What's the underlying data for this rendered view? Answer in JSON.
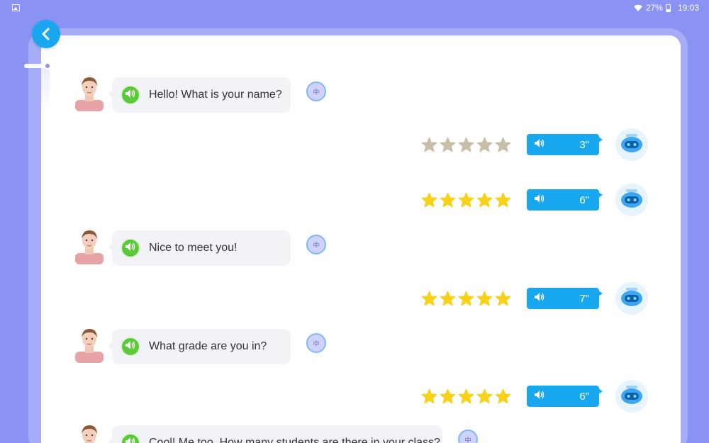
{
  "status_bar": {
    "battery": "27%",
    "time": "19:03"
  },
  "colors": {
    "background": "#8a93f3",
    "accent": "#17a8ef",
    "speaker_green": "#5cc93b",
    "star_gold": "#f8d21a",
    "star_gray": "#c8bfa9"
  },
  "conversation": {
    "teacher_messages": [
      {
        "text": "Hello! What is your name?",
        "translate_label": "中"
      },
      {
        "text": "Nice to meet you!",
        "translate_label": "中"
      },
      {
        "text": "What grade are you in?",
        "translate_label": "中"
      },
      {
        "text": "Cool! Me too. How many students are there in your class?",
        "translate_label": "中"
      }
    ],
    "student_replies": [
      {
        "duration": "3\"",
        "stars_filled": 0,
        "stars_total": 5
      },
      {
        "duration": "6\"",
        "stars_filled": 5,
        "stars_total": 5
      },
      {
        "duration": "7\"",
        "stars_filled": 5,
        "stars_total": 5
      },
      {
        "duration": "6\"",
        "stars_filled": 5,
        "stars_total": 5
      }
    ]
  }
}
